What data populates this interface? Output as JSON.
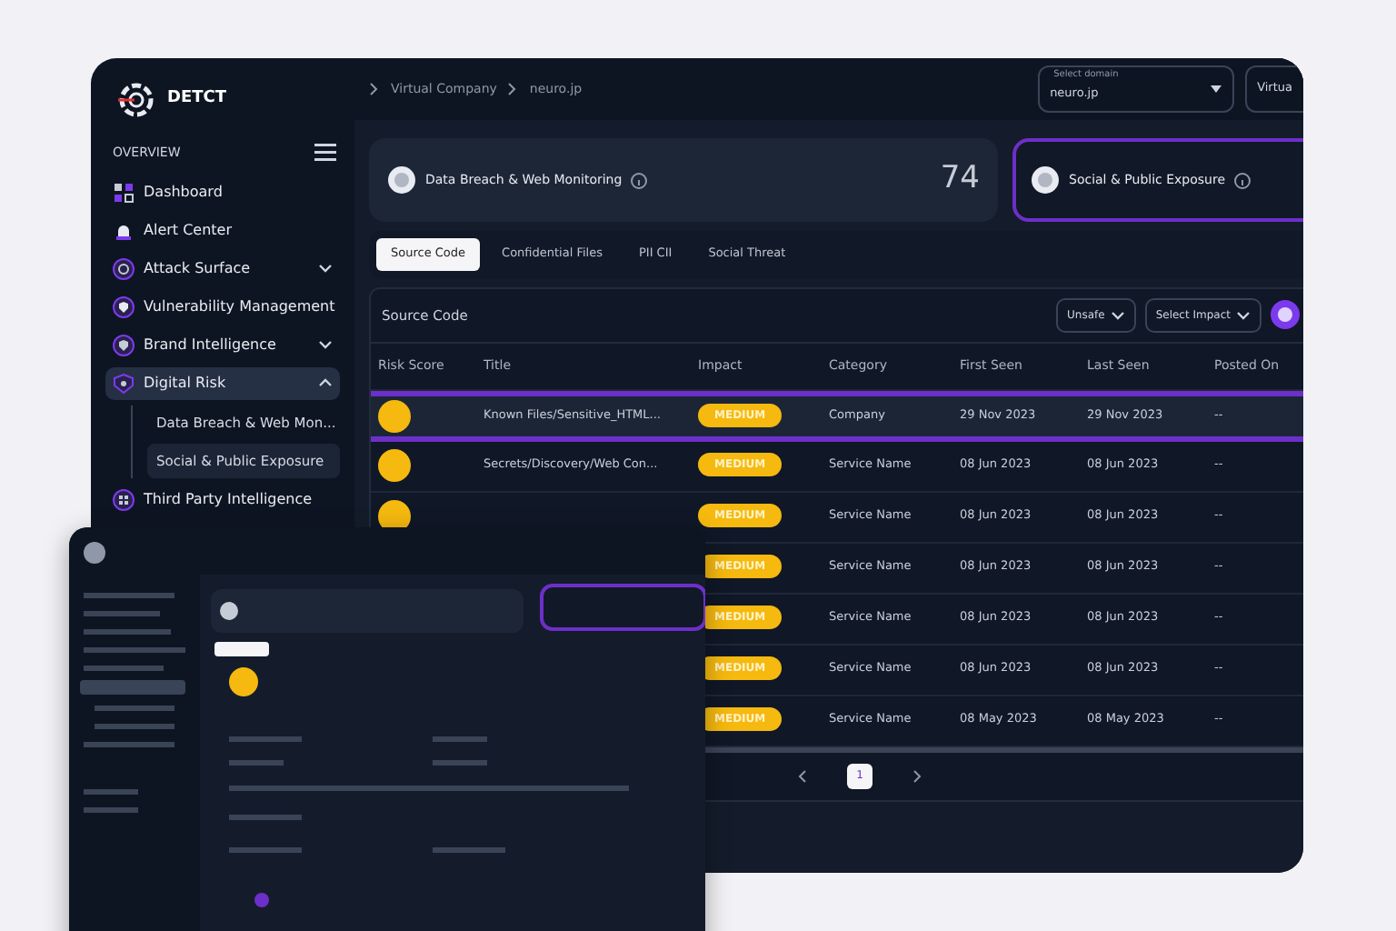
{
  "brand": {
    "name": "DETCT"
  },
  "sidebar": {
    "section": "OVERVIEW",
    "items": [
      {
        "label": "Dashboard",
        "selected": false
      },
      {
        "label": "Alert Center",
        "selected": false
      },
      {
        "label": "Attack Surface",
        "selected": false,
        "expanded": false
      },
      {
        "label": "Vulnerability Management",
        "selected": false
      },
      {
        "label": "Brand Intelligence",
        "selected": false,
        "expanded": false
      },
      {
        "label": "Digital Risk",
        "selected": true,
        "expanded": true,
        "children": [
          {
            "label": "Data Breach & Web Mon...",
            "selected": false
          },
          {
            "label": "Social & Public Exposure",
            "selected": true
          }
        ]
      },
      {
        "label": "Third Party Intelligence",
        "selected": false
      }
    ]
  },
  "breadcrumb": [
    "Virtual Company",
    "neuro.jp"
  ],
  "domain_select": {
    "label": "Select domain",
    "value": "neuro.jp"
  },
  "second_select": {
    "value": "Virtua"
  },
  "summary_cards": [
    {
      "title": "Data Breach & Web Monitoring",
      "count": "74",
      "selected": false
    },
    {
      "title": "Social & Public Exposure",
      "selected": true
    }
  ],
  "tabs": [
    {
      "label": "Source Code",
      "selected": true
    },
    {
      "label": "Confidential Files",
      "selected": false
    },
    {
      "label": "PII CII",
      "selected": false
    },
    {
      "label": "Social Threat",
      "selected": false
    }
  ],
  "table": {
    "title": "Source Code",
    "filters": [
      "Unsafe",
      "Select Impact"
    ],
    "columns": [
      "Risk Score",
      "Title",
      "Impact",
      "Category",
      "First Seen",
      "Last Seen",
      "Posted On"
    ],
    "rows": [
      {
        "title": "Known Files/Sensitive_HTML...",
        "impact": "MEDIUM",
        "category": "Company",
        "first_seen": "29 Nov 2023",
        "last_seen": "29 Nov 2023",
        "posted_on": "--",
        "selected": true
      },
      {
        "title": "Secrets/Discovery/Web Con...",
        "impact": "MEDIUM",
        "category": "Service Name",
        "first_seen": "08 Jun 2023",
        "last_seen": "08 Jun 2023",
        "posted_on": "--",
        "selected": false
      },
      {
        "impact": "MEDIUM",
        "category": "Service Name",
        "first_seen": "08 Jun 2023",
        "last_seen": "08 Jun 2023",
        "posted_on": "--",
        "selected": false
      },
      {
        "impact": "MEDIUM",
        "category": "Service Name",
        "first_seen": "08 Jun 2023",
        "last_seen": "08 Jun 2023",
        "posted_on": "--",
        "selected": false
      },
      {
        "impact": "MEDIUM",
        "category": "Service Name",
        "first_seen": "08 Jun 2023",
        "last_seen": "08 Jun 2023",
        "posted_on": "--",
        "selected": false
      },
      {
        "impact": "MEDIUM",
        "category": "Service Name",
        "first_seen": "08 Jun 2023",
        "last_seen": "08 Jun 2023",
        "posted_on": "--",
        "selected": false
      },
      {
        "impact": "MEDIUM",
        "category": "Service Name",
        "first_seen": "08 May 2023",
        "last_seen": "08 May 2023",
        "posted_on": "--",
        "selected": false
      }
    ]
  },
  "pagination": [
    {
      "label": "1",
      "selected": true
    }
  ]
}
